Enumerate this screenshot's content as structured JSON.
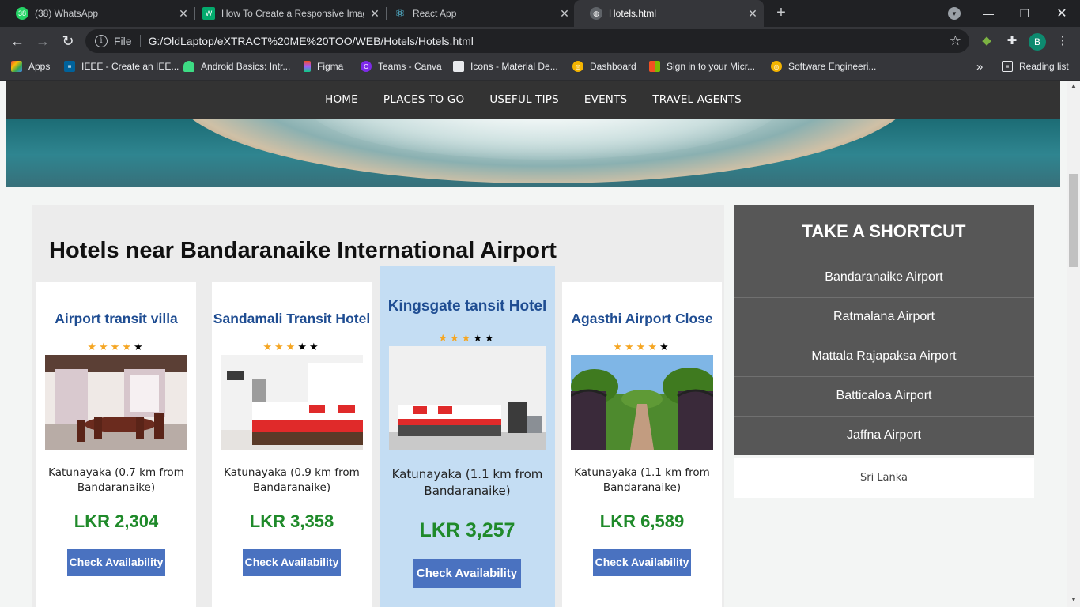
{
  "browser": {
    "tabs": [
      {
        "title": "(38) WhatsApp",
        "favicon": "whatsapp-icon",
        "badge": "38"
      },
      {
        "title": "How To Create a Responsive Imag",
        "favicon": "w3schools-icon"
      },
      {
        "title": "React App",
        "favicon": "react-icon"
      },
      {
        "title": "Hotels.html",
        "favicon": "globe-icon",
        "active": true
      }
    ],
    "url_scheme": "File",
    "url": "G:/OldLaptop/eXTRACT%20ME%20TOO/WEB/Hotels/Hotels.html",
    "avatar_letter": "B",
    "bookmarks": [
      {
        "label": "Apps",
        "icon": "apps-grid-icon"
      },
      {
        "label": "IEEE - Create an IEE...",
        "icon": "ieee-icon"
      },
      {
        "label": "Android Basics: Intr...",
        "icon": "android-icon"
      },
      {
        "label": "Figma",
        "icon": "figma-icon"
      },
      {
        "label": "Teams - Canva",
        "icon": "canva-icon"
      },
      {
        "label": "Icons - Material De...",
        "icon": "material-icon"
      },
      {
        "label": "Dashboard",
        "icon": "dashboard-icon"
      },
      {
        "label": "Sign in to your Micr...",
        "icon": "microsoft-icon"
      },
      {
        "label": "Software Engineeri...",
        "icon": "software-engineering-icon"
      }
    ],
    "overflow": "»",
    "reading_list": "Reading list"
  },
  "nav": {
    "items": [
      "HOME",
      "PLACES TO GO",
      "USEFUL TIPS",
      "EVENTS",
      "TRAVEL AGENTS"
    ]
  },
  "main": {
    "title": "Hotels near Bandaranaike International Airport",
    "button_label": "Check Availability",
    "hotels": [
      {
        "name": "Airport transit villa",
        "rating": 4,
        "max_rating": 5,
        "location": "Katunayaka (0.7 km from Bandaranaike)",
        "price": "LKR 2,304",
        "photo": "dining-room"
      },
      {
        "name": "Sandamali Transit Hotel",
        "rating": 3,
        "max_rating": 5,
        "location": "Katunayaka (0.9 km from Bandaranaike)",
        "price": "LKR 3,358",
        "photo": "bedroom"
      },
      {
        "name": "Kingsgate tansit Hotel",
        "rating": 3,
        "max_rating": 5,
        "location": "Katunayaka (1.1 km from Bandaranaike)",
        "price": "LKR 3,257",
        "photo": "bedroom",
        "featured": true
      },
      {
        "name": "Agasthi Airport Close",
        "rating": 4,
        "max_rating": 5,
        "location": "Katunayaka (1.1 km from Bandaranaike)",
        "price": "LKR 6,589",
        "photo": "garden-gate"
      }
    ]
  },
  "sidebar": {
    "title": "TAKE A SHORTCUT",
    "items": [
      "Bandaranaike Airport",
      "Ratmalana Airport",
      "Mattala Rajapaksa Airport",
      "Batticaloa Airport",
      "Jaffna Airport"
    ],
    "footer": "Sri Lanka"
  }
}
